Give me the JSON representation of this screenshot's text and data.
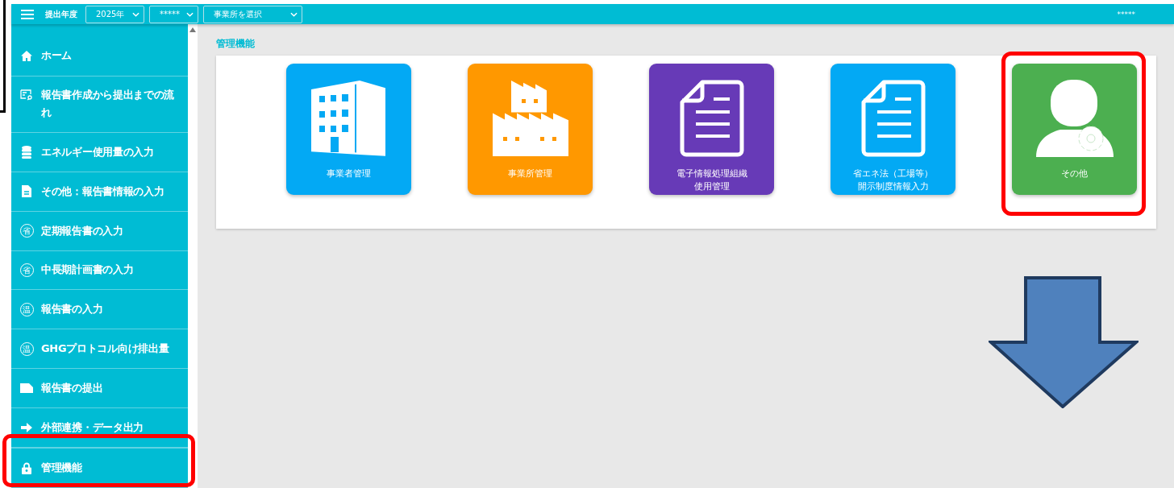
{
  "topbar": {
    "label": "提出年度",
    "selects": [
      {
        "value": "2025年"
      },
      {
        "value": "*****"
      },
      {
        "value": "事業所を選択"
      }
    ],
    "user": "*****"
  },
  "sidebar": {
    "items": [
      {
        "kind": "home",
        "label": "ホーム"
      },
      {
        "kind": "flow",
        "label": "報告書作成から提出までの流れ"
      },
      {
        "kind": "database",
        "label": "エネルギー使用量の入力"
      },
      {
        "kind": "file",
        "label": "その他：報告書情報の入力"
      },
      {
        "kind": "badge",
        "badge": "省",
        "label": "定期報告書の入力"
      },
      {
        "kind": "badge",
        "badge": "省",
        "label": "中長期計画書の入力"
      },
      {
        "kind": "badge",
        "badge": "温",
        "label": "報告書の入力"
      },
      {
        "kind": "badge",
        "badge": "温",
        "label": "GHGプロトコル向け排出量"
      },
      {
        "kind": "note",
        "label": "報告書の提出"
      },
      {
        "kind": "arrow",
        "label": "外部連携・データ出力"
      },
      {
        "kind": "lock",
        "label": "管理機能"
      }
    ]
  },
  "main": {
    "title": "管理機能",
    "tiles": [
      {
        "kind": "building",
        "color": "#03a9f4",
        "lines": [
          "事業者管理"
        ]
      },
      {
        "kind": "factory",
        "color": "#ff9800",
        "lines": [
          "事業所管理"
        ]
      },
      {
        "kind": "document",
        "color": "#673ab7",
        "lines": [
          "電子情報処理組織",
          "使用管理"
        ]
      },
      {
        "kind": "document",
        "color": "#03a9f4",
        "lines": [
          "省エネ法（工場等）",
          "開示制度情報入力"
        ]
      },
      {
        "kind": "user-gear",
        "color": "#4caf50",
        "lines": [
          "その他"
        ]
      }
    ]
  },
  "annotations": [
    {
      "kind": "frame"
    },
    {
      "kind": "highlight"
    },
    {
      "kind": "highlight"
    },
    {
      "kind": "arrow"
    }
  ]
}
